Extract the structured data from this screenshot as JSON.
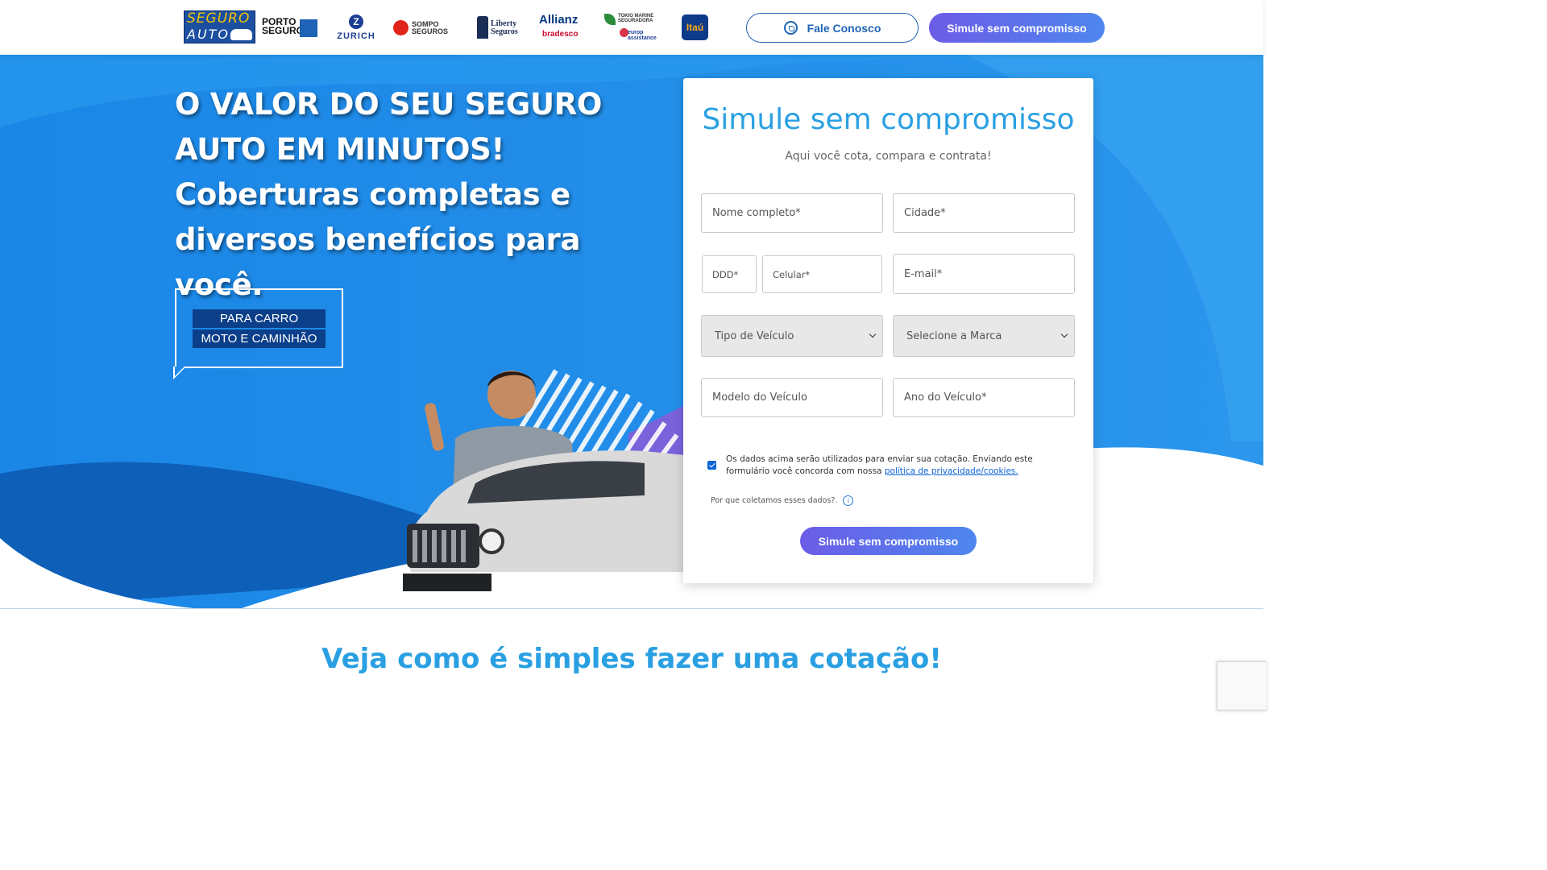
{
  "header": {
    "logo": {
      "line1": "SEGURO",
      "line2": "AUTO"
    },
    "partners": [
      {
        "name": "PORTO SEGURO",
        "icon": "porto-seguro-logo"
      },
      {
        "name": "ZURICH",
        "icon": "zurich-logo"
      },
      {
        "name": "SOMPO SEGUROS",
        "icon": "sompo-logo"
      },
      {
        "name": "Liberty Seguros",
        "icon": "liberty-logo"
      },
      {
        "name": "Allianz",
        "icon": "allianz-logo"
      },
      {
        "name": "bradesco",
        "icon": "bradesco-logo"
      },
      {
        "name": "TOKIO MARINE SEGURADORA",
        "icon": "tokio-marine-logo"
      },
      {
        "name": "europ assistance",
        "icon": "europ-assistance-logo"
      },
      {
        "name": "Itaú",
        "icon": "itau-logo"
      }
    ],
    "contact_label": "Fale Conosco",
    "contact_icon": "whatsapp-icon",
    "cta_label": "Simule sem compromisso"
  },
  "hero": {
    "title": "O VALOR DO SEU SEGURO AUTO EM MINUTOS! Coberturas completas e diversos benefícios para você.",
    "tag_line1": "PARA CARRO",
    "tag_line2": "MOTO E CAMINHÃO"
  },
  "form": {
    "title": "Simule sem compromisso",
    "subtitle": "Aqui você cota, compara e contrata!",
    "fields": {
      "nome": {
        "placeholder": "Nome completo*",
        "value": ""
      },
      "cidade": {
        "placeholder": "Cidade*",
        "value": ""
      },
      "ddd": {
        "placeholder": "DDD*",
        "value": ""
      },
      "celular": {
        "placeholder": "Celular*",
        "value": ""
      },
      "email": {
        "placeholder": "E-mail*",
        "value": ""
      },
      "tipo": {
        "selected": "Tipo de Veículo"
      },
      "marca": {
        "selected": "Selecione a Marca"
      },
      "modelo": {
        "placeholder": "Modelo do Veículo",
        "value": ""
      },
      "ano": {
        "placeholder": "Ano do Veículo*",
        "value": ""
      }
    },
    "consent_text": "Os dados acima serão utilizados para enviar sua cotação. Enviando este formulário você concorda com nossa",
    "consent_link": "política de privacidade/cookies.",
    "consent_checked": true,
    "why_label": "Por que coletamos esses dados?.",
    "info_icon": "info-icon",
    "submit_label": "Simule sem compromisso"
  },
  "section": {
    "title": "Veja como é simples fazer uma cotação!"
  },
  "colors": {
    "hero_blue": "#1e8fe8",
    "title_blue": "#2aa0e3",
    "button_gradient_start": "#6c5ce7",
    "button_gradient_end": "#4e86ee",
    "tag_navy": "#0b3f8a"
  }
}
